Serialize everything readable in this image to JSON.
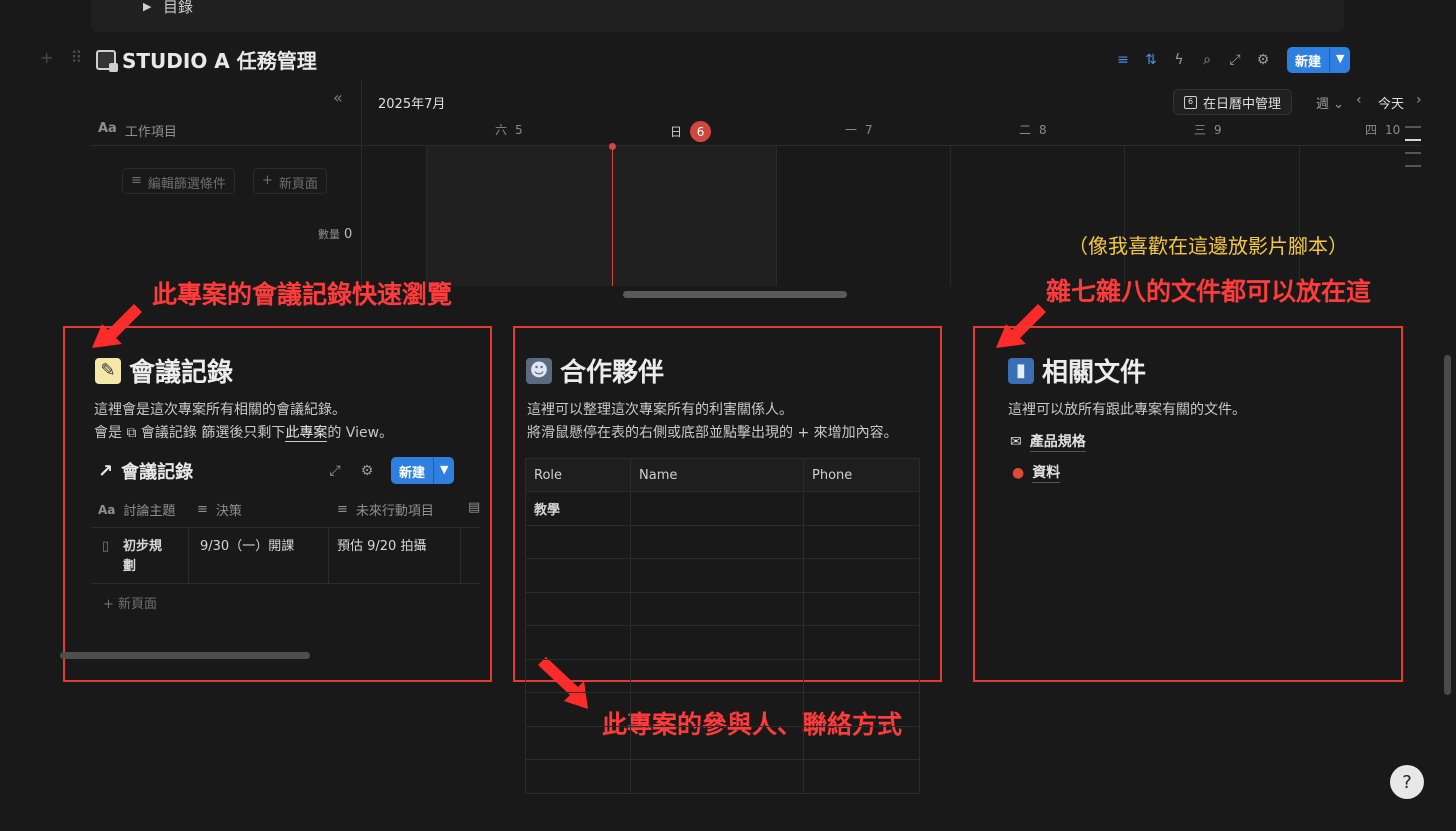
{
  "toggle": {
    "label": "目錄"
  },
  "database": {
    "title": "STUDIO A 任務管理",
    "new_label": "新建",
    "column_header": "工作項目",
    "filter_label": "編輯篩選條件",
    "new_page_label": "新頁面",
    "count_label": "數量",
    "count_value": "0"
  },
  "timeline": {
    "month": "2025年7月",
    "calendar_button": "在日曆中管理",
    "view_select": "週",
    "today_label": "今天",
    "days": [
      {
        "weekday": "六",
        "num": "5"
      },
      {
        "weekday": "日",
        "num": "6"
      },
      {
        "weekday": "一",
        "num": "7"
      },
      {
        "weekday": "二",
        "num": "8"
      },
      {
        "weekday": "三",
        "num": "9"
      },
      {
        "weekday": "四",
        "num": "10"
      }
    ]
  },
  "annotations": {
    "meeting": "此專案的會議記錄快速瀏覽",
    "docs_note": "（像我喜歡在這邊放影片腳本）",
    "docs": "雜七雜八的文件都可以放在這",
    "partners": "此專案的參與人、聯絡方式"
  },
  "meeting_section": {
    "heading": "會議記錄",
    "desc_line1": "這裡會是這次專案所有相關的會議紀錄。",
    "desc_pre": "會是",
    "desc_link": "會議記錄",
    "desc_mid": "篩選後只剩下",
    "desc_under": "此專案",
    "desc_post": "的 View。",
    "view_title": "會議記錄",
    "new_label": "新建",
    "columns": [
      "討論主題",
      "決策",
      "未來行動項目"
    ],
    "rows": [
      {
        "topic": "初步規劃",
        "decision": "9/30（一）開課",
        "action": "預估 9/20 拍攝"
      }
    ],
    "new_page": "新頁面"
  },
  "partners_section": {
    "heading": "合作夥伴",
    "desc_line1": "這裡可以整理這次專案所有的利害關係人。",
    "desc_line2": "將滑鼠懸停在表的右側或底部並點擊出現的 + 來增加內容。",
    "columns": [
      "Role",
      "Name",
      "Phone"
    ],
    "rows": [
      [
        "教學",
        "",
        ""
      ]
    ]
  },
  "docs_section": {
    "heading": "相關文件",
    "desc": "這裡可以放所有跟此專案有關的文件。",
    "items": [
      {
        "icon": "inbox-tray-icon",
        "label": "產品規格"
      },
      {
        "icon": "pin-icon",
        "label": "資料"
      }
    ]
  },
  "colors": {
    "accent": "#2f7fe0",
    "annotation_red": "#e53935",
    "today": "#d0483d",
    "note_yellow": "#f5c842"
  }
}
